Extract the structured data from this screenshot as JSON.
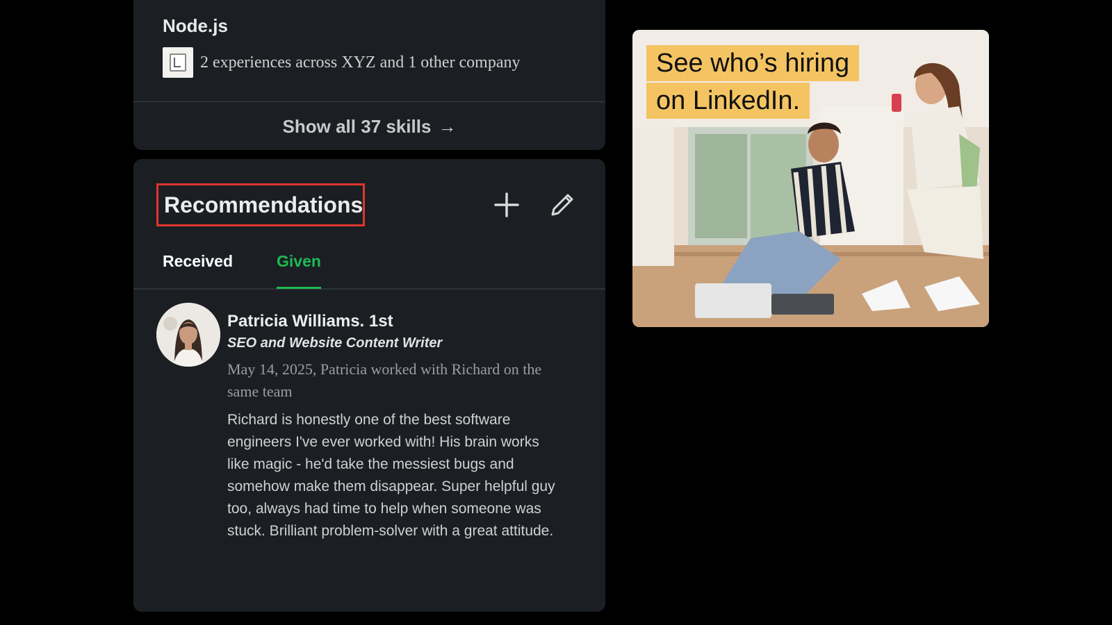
{
  "skills_section": {
    "skill_name": "Node.js",
    "experience_text": "2 experiences across XYZ and 1 other company",
    "show_all_label": "Show all 37 skills",
    "show_all_arrow": "→"
  },
  "recommendations": {
    "title": "Recommendations",
    "add_icon": "plus-icon",
    "edit_icon": "pencil-icon",
    "tabs": [
      {
        "label": "Received",
        "active": false
      },
      {
        "label": "Given",
        "active": true
      }
    ],
    "item": {
      "name": "Patricia Williams. 1st",
      "role": "SEO and Website Content Writer",
      "meta": "May 14, 2025, Patricia worked with Richard on the same team",
      "body": "Richard is honestly one of the best software engineers I've ever worked with! His brain works like magic - he'd take the messiest bugs and somehow make them disappear. Super helpful guy too, always had time to help when someone was stuck. Brilliant problem-solver with a great attitude."
    }
  },
  "ad": {
    "line1": "See who’s hiring",
    "line2": "on LinkedIn."
  },
  "colors": {
    "background": "#000000",
    "card": "#1b1f23",
    "accent_green": "#1fb954",
    "highlight_red": "#e0352f",
    "ad_yellow": "#f4c463"
  }
}
